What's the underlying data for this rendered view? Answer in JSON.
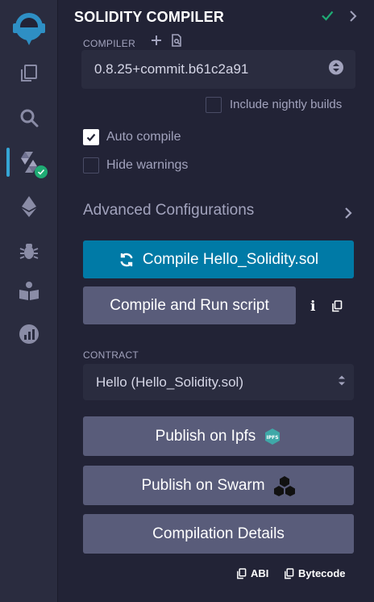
{
  "app": {
    "panel_title": "SOLIDITY COMPILER"
  },
  "rail": {
    "items": [
      {
        "name": "logo",
        "icon": "remix-logo-icon"
      },
      {
        "name": "file-explorer",
        "icon": "files-icon"
      },
      {
        "name": "search",
        "icon": "search-icon"
      },
      {
        "name": "solidity-compiler",
        "icon": "solidity-icon",
        "active": true,
        "badge": "check"
      },
      {
        "name": "deploy-run",
        "icon": "ethereum-icon"
      },
      {
        "name": "debugger",
        "icon": "bug-icon"
      },
      {
        "name": "learneth",
        "icon": "book-icon"
      },
      {
        "name": "analytics",
        "icon": "chart-icon"
      }
    ]
  },
  "compiler": {
    "label": "COMPILER",
    "version": "0.8.25+commit.b61c2a91",
    "include_nightly_label": "Include nightly builds",
    "include_nightly": false
  },
  "options": {
    "auto_compile_label": "Auto compile",
    "auto_compile": true,
    "hide_warnings_label": "Hide warnings",
    "hide_warnings": false
  },
  "advanced": {
    "label": "Advanced Configurations"
  },
  "actions": {
    "compile_label": "Compile Hello_Solidity.sol",
    "compile_run_label": "Compile and Run script",
    "info_symbol": "i"
  },
  "contract": {
    "label": "CONTRACT",
    "selected": "Hello (Hello_Solidity.sol)"
  },
  "publish": {
    "ipfs_label": "Publish on Ipfs",
    "ipfs_badge": "IPFS",
    "swarm_label": "Publish on Swarm",
    "details_label": "Compilation Details"
  },
  "footer": {
    "abi_label": "ABI",
    "bytecode_label": "Bytecode"
  },
  "colors": {
    "background": "#222336",
    "rail": "#2a2c3f",
    "primary": "#007aa6",
    "secondary": "#595c7a",
    "success": "#1fab74",
    "active_bar": "#35a6d6"
  }
}
